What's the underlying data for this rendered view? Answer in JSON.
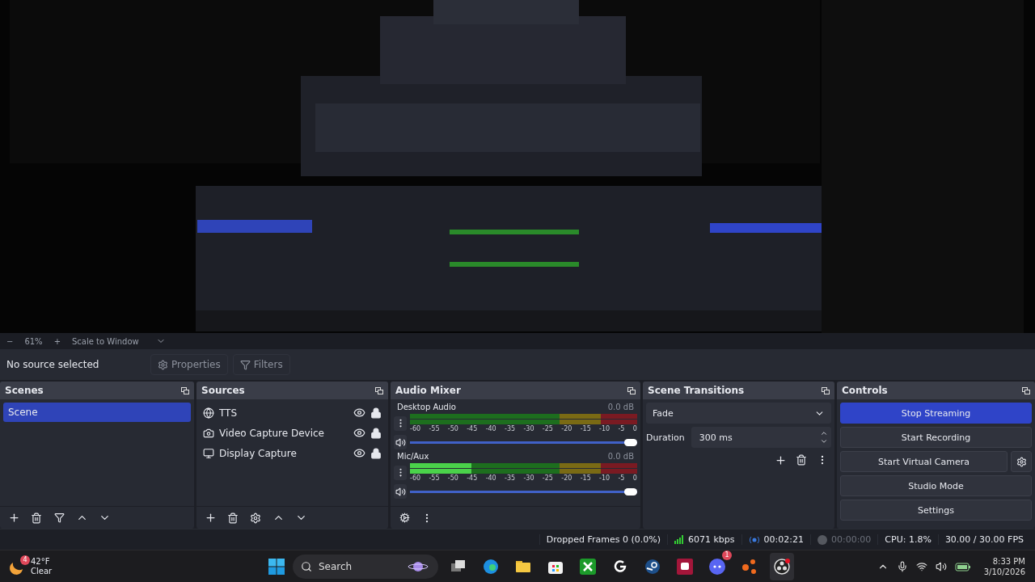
{
  "zoom_bar": {
    "zoom_out": "−",
    "zoom": "61%",
    "zoom_in": "+",
    "scale_mode": "Scale to Window"
  },
  "context_bar": {
    "message": "No source selected",
    "buttons": [
      {
        "kind": "properties",
        "label": "Properties"
      },
      {
        "kind": "filters",
        "label": "Filters"
      }
    ]
  },
  "scenes": {
    "title": "Scenes",
    "items": [
      {
        "label": "Scene",
        "selected": true
      }
    ]
  },
  "sources": {
    "title": "Sources",
    "items": [
      {
        "label": "TTS",
        "kind": "browser",
        "visible": true,
        "locked": true
      },
      {
        "label": "Video Capture Device",
        "kind": "camera",
        "visible": true,
        "locked": true
      },
      {
        "label": "Display Capture",
        "kind": "display",
        "visible": true,
        "locked": true
      }
    ]
  },
  "audio_mixer": {
    "title": "Audio Mixer",
    "channels": [
      {
        "name": "Desktop Audio",
        "reading": "0.0 dB",
        "meter": {
          "level": 0
        },
        "volume": {
          "level": 1
        },
        "scale": [
          "-60",
          "-55",
          "-50",
          "-45",
          "-40",
          "-35",
          "-30",
          "-25",
          "-20",
          "-15",
          "-10",
          "-5",
          "0"
        ]
      },
      {
        "name": "Mic/Aux",
        "reading": "0.0 dB",
        "meter": {
          "level": 0.27
        },
        "volume": {
          "level": 1
        },
        "scale": [
          "-60",
          "-55",
          "-50",
          "-45",
          "-40",
          "-35",
          "-30",
          "-25",
          "-20",
          "-15",
          "-10",
          "-5",
          "0"
        ]
      }
    ]
  },
  "scene_transitions": {
    "title": "Scene Transitions",
    "transition": "Fade",
    "duration_label": "Duration",
    "duration": "300 ms"
  },
  "controls": {
    "title": "Controls",
    "buttons": [
      {
        "label": "Stop Streaming",
        "active": true,
        "has_settings": false
      },
      {
        "label": "Start Recording",
        "active": false,
        "has_settings": false
      },
      {
        "label": "Start Virtual Camera",
        "active": false,
        "has_settings": true
      },
      {
        "label": "Studio Mode",
        "active": false,
        "has_settings": false
      },
      {
        "label": "Settings",
        "active": false,
        "has_settings": false
      }
    ]
  },
  "status_bar": {
    "dropped_frames": "Dropped Frames 0 (0.0%)",
    "bitrate": "6071 kbps",
    "stream_time": "00:02:21",
    "record_time": "00:00:00",
    "cpu": "CPU: 1.8%",
    "fps": "30.00 / 30.00 FPS"
  },
  "taskbar": {
    "weather": {
      "badge": "4",
      "temperature": "42°F",
      "condition": "Clear"
    },
    "search": {
      "placeholder": "Search"
    },
    "apps": [
      {
        "kind": "taskview"
      },
      {
        "kind": "edge"
      },
      {
        "kind": "folder"
      },
      {
        "kind": "store"
      },
      {
        "kind": "xbox"
      },
      {
        "kind": "g"
      },
      {
        "kind": "steam"
      },
      {
        "kind": "red"
      },
      {
        "kind": "discord",
        "badge": "1"
      },
      {
        "kind": "dots"
      },
      {
        "kind": "obs",
        "selected": true
      }
    ],
    "clock": {
      "time": "8:33 PM",
      "date": "3/10/2026"
    }
  }
}
